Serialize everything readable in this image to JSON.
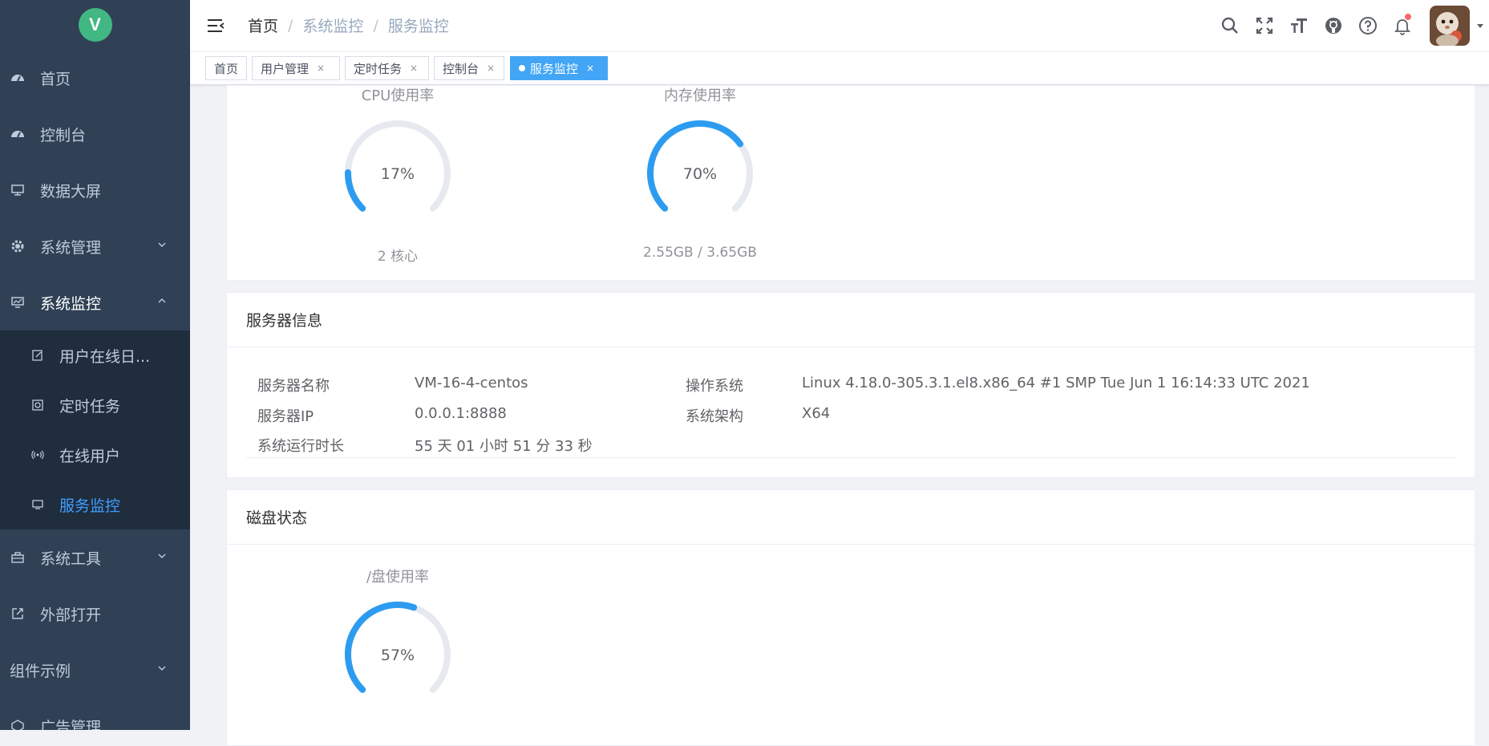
{
  "logo": {
    "letter": "V"
  },
  "sidebar": {
    "items": [
      {
        "label": "首页"
      },
      {
        "label": "控制台"
      },
      {
        "label": "数据大屏"
      },
      {
        "label": "系统管理"
      },
      {
        "label": "系统监控"
      },
      {
        "label": "系统工具"
      },
      {
        "label": "外部打开"
      },
      {
        "label": "组件示例"
      },
      {
        "label": "广告管理"
      }
    ],
    "monitor_children": [
      {
        "label": "用户在线日..."
      },
      {
        "label": "定时任务"
      },
      {
        "label": "在线用户"
      },
      {
        "label": "服务监控"
      }
    ]
  },
  "breadcrumb": [
    "首页",
    "系统监控",
    "服务监控"
  ],
  "tags": [
    {
      "label": "首页"
    },
    {
      "label": "用户管理"
    },
    {
      "label": "定时任务"
    },
    {
      "label": "控制台"
    },
    {
      "label": "服务监控"
    }
  ],
  "resource": {
    "cpu": {
      "title": "CPU使用率",
      "value": "17%",
      "percent": 17,
      "sub": "2 核心"
    },
    "mem": {
      "title": "内存使用率",
      "value": "70%",
      "percent": 70,
      "sub": "2.55GB / 3.65GB"
    }
  },
  "server_info": {
    "title": "服务器信息",
    "name_label": "服务器名称",
    "name": "VM-16-4-centos",
    "os_label": "操作系统",
    "os": "Linux 4.18.0-305.3.1.el8.x86_64 #1 SMP Tue Jun 1 16:14:33 UTC 2021",
    "ip_label": "服务器IP",
    "ip": "0.0.0.1:8888",
    "arch_label": "系统架构",
    "arch": "X64",
    "uptime_label": "系统运行时长",
    "uptime": "55 天 01 小时 51 分 33 秒"
  },
  "disk": {
    "title": "磁盘状态",
    "gauge_title": "/盘使用率",
    "value": "57%",
    "percent": 57
  },
  "colors": {
    "sidebar_bg": "#304156",
    "submenu_bg": "#1f2d3d",
    "accent": "#409eff",
    "gauge": "#2d9cf0",
    "gauge_track": "#e6e9f0",
    "logo": "#41b883"
  }
}
